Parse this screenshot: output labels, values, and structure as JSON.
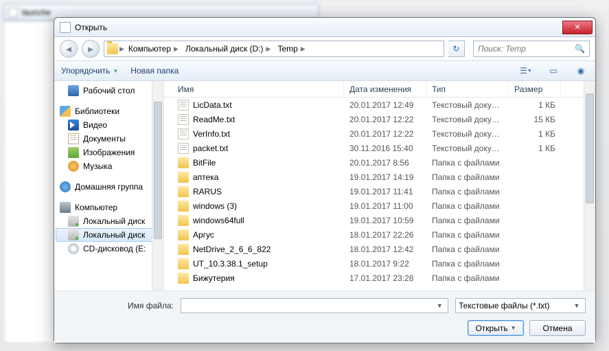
{
  "background": {
    "tab_title": "launche"
  },
  "dialog": {
    "title": "Открыть",
    "breadcrumb": [
      "Компьютер",
      "Локальный диск (D:)",
      "Temp"
    ],
    "search_placeholder": "Поиск: Temp",
    "toolbar": {
      "organize": "Упорядочить",
      "new_folder": "Новая папка"
    },
    "columns": {
      "name": "Имя",
      "date": "Дата изменения",
      "type": "Тип",
      "size": "Размер"
    },
    "sidebar": {
      "desktop": "Рабочий стол",
      "libraries": "Библиотеки",
      "videos": "Видео",
      "documents": "Документы",
      "pictures": "Изображения",
      "music": "Музыка",
      "homegroup": "Домашняя группа",
      "computer": "Компьютер",
      "localdisk1": "Локальный диск",
      "localdisk2": "Локальный диск",
      "cd": "CD-дисковод (E:"
    },
    "files": [
      {
        "icon": "txt",
        "name": "LicData.txt",
        "date": "20.01.2017 12:49",
        "type": "Текстовый докум...",
        "size": "1 КБ"
      },
      {
        "icon": "txt",
        "name": "ReadMe.txt",
        "date": "20.01.2017 12:22",
        "type": "Текстовый докум...",
        "size": "15 КБ"
      },
      {
        "icon": "txt",
        "name": "VerInfo.txt",
        "date": "20.01.2017 12:22",
        "type": "Текстовый докум...",
        "size": "1 КБ"
      },
      {
        "icon": "txt",
        "name": "packet.txt",
        "date": "30.11.2016 15:40",
        "type": "Текстовый докум...",
        "size": "1 КБ"
      },
      {
        "icon": "folder",
        "name": "BitFile",
        "date": "20.01.2017 8:56",
        "type": "Папка с файлами",
        "size": ""
      },
      {
        "icon": "folder",
        "name": "аптека",
        "date": "19.01.2017 14:19",
        "type": "Папка с файлами",
        "size": ""
      },
      {
        "icon": "folder",
        "name": "RARUS",
        "date": "19.01.2017 11:41",
        "type": "Папка с файлами",
        "size": ""
      },
      {
        "icon": "folder",
        "name": "windows (3)",
        "date": "19.01.2017 11:00",
        "type": "Папка с файлами",
        "size": ""
      },
      {
        "icon": "folder",
        "name": "windows64full",
        "date": "19.01.2017 10:59",
        "type": "Папка с файлами",
        "size": ""
      },
      {
        "icon": "folder",
        "name": "Аргус",
        "date": "18.01.2017 22:26",
        "type": "Папка с файлами",
        "size": ""
      },
      {
        "icon": "folder",
        "name": "NetDrive_2_6_6_822",
        "date": "18.01.2017 12:42",
        "type": "Папка с файлами",
        "size": ""
      },
      {
        "icon": "folder",
        "name": "UT_10.3.38.1_setup",
        "date": "18.01.2017 9:22",
        "type": "Папка с файлами",
        "size": ""
      },
      {
        "icon": "folder",
        "name": "Бижутерия",
        "date": "17.01.2017 23:28",
        "type": "Папка с файлами",
        "size": ""
      }
    ],
    "filename_label": "Имя файла:",
    "filetype_value": "Текстовые файлы (*.txt)",
    "open_btn": "Открыть",
    "cancel_btn": "Отмена"
  }
}
